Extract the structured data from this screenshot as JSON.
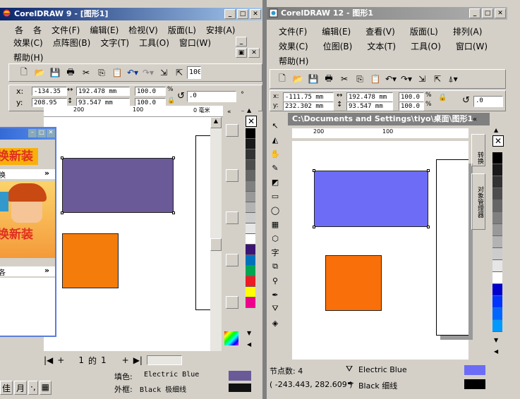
{
  "left_window": {
    "title": "CorelDRAW 9 - [图形1]",
    "menu_row1": [
      "各",
      "各",
      "文件(F)",
      "编辑(E)",
      "检视(V)",
      "版面(L)",
      "安排(A)"
    ],
    "menu_row2": [
      "效果(C)",
      "点阵图(B)",
      "文字(T)",
      "工具(O)",
      "窗口(W)",
      "帮助(H)"
    ],
    "zoom_value": "100%",
    "props": {
      "x_label": "x:",
      "x_value": "-134.35",
      "y_label": "y:",
      "y_value": "208.95",
      "w_value": "192.478 mm",
      "h_value": "93.547 mm",
      "scale_w": "100.0",
      "scale_h": "100.0",
      "pct": "%",
      "angle": ".0"
    },
    "ruler_labels": [
      "200",
      "100",
      "0 毫米"
    ],
    "page_nav": {
      "current": "1",
      "of": "的",
      "total": "1"
    },
    "status": {
      "fill_label": "填色:",
      "fill_value": "Electric Blue",
      "outline_label": "外框:",
      "outline_value": "Black  极细线"
    }
  },
  "right_window": {
    "title": "CorelDRAW 12 - 图形1",
    "menu_row1": [
      "文件(F)",
      "编辑(E)",
      "查看(V)",
      "版面(L)",
      "排列(A)"
    ],
    "menu_row2": [
      "效果(C)",
      "位图(B)",
      "文本(T)",
      "工具(O)",
      "窗口(W)"
    ],
    "menu_row3": [
      "帮助(H)"
    ],
    "props": {
      "x_label": "x:",
      "x_value": "-111.75 mm",
      "y_label": "y:",
      "y_value": "232.302 mm",
      "w_value": "192.478 mm",
      "h_value": "93.547 mm",
      "scale_w": "100.0",
      "scale_h": "100.0",
      "pct": "%",
      "angle": ".0"
    },
    "doc_title": "C:\\Documents and Settings\\tiyo\\桌面\\图形1",
    "ruler_labels": [
      "200",
      "100"
    ],
    "docker_tabs": [
      "转换",
      "对象管理器"
    ],
    "status": {
      "nodes_label": "节点数: 4",
      "coords": "( -243.443, 282.609 )",
      "fill_value": "Electric Blue",
      "outline_value": "Black  细线"
    }
  },
  "popup": {
    "banner_text": "换新装",
    "row_label": "换",
    "row_label2": "各",
    "arrows": "»"
  },
  "taskbar": {
    "items": [
      "佳",
      "月",
      "·,",
      "▦"
    ]
  },
  "colors": {
    "cd9_rect": "#6a5a97",
    "cd12_rect": "#6c6cf7",
    "orange": "#f37c0b",
    "orange12": "#f9700a",
    "titlebar_active": "#0a246a",
    "titlebar_inactive": "#7b7b7b"
  }
}
